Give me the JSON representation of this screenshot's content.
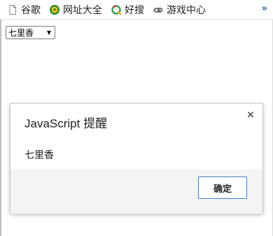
{
  "bookmarks": {
    "items": [
      {
        "label": "谷歌",
        "icon": "page-icon"
      },
      {
        "label": "网址大全",
        "icon": "hao123-icon"
      },
      {
        "label": "好搜",
        "icon": "haosou-icon"
      },
      {
        "label": "游戏中心",
        "icon": "gamepad-icon"
      }
    ],
    "more": "»"
  },
  "select": {
    "value": "七里香"
  },
  "dialog": {
    "title": "JavaScript 提醒",
    "close": "×",
    "message": "七里香",
    "ok_label": "确定"
  },
  "colors": {
    "accent_border": "#4a7dc9",
    "footer_bg": "#f4f4f4"
  }
}
